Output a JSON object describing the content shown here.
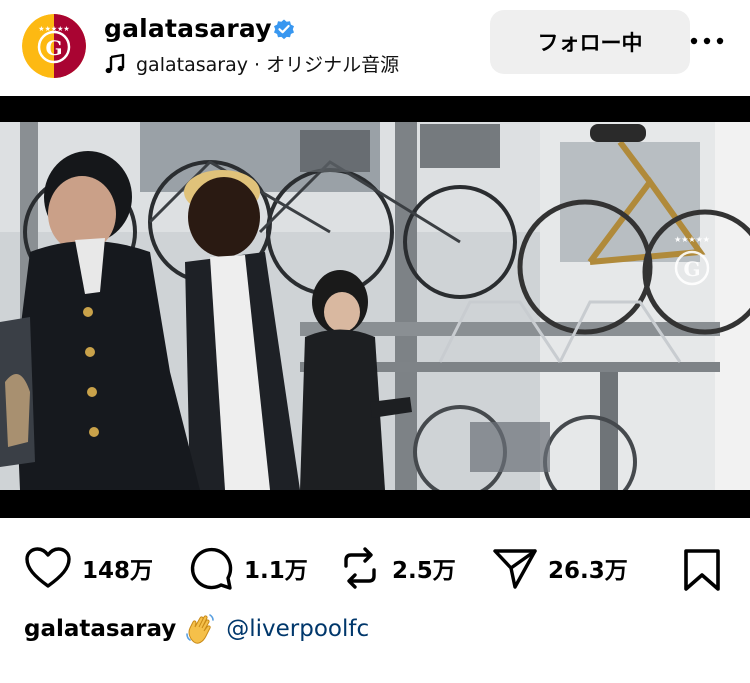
{
  "header": {
    "account_name": "galatasaray",
    "audio_label": "galatasaray · オリジナル音源",
    "follow_label": "フォロー中",
    "more_icon": "more-horizontal-icon",
    "verified_color": "#3897f0"
  },
  "media": {
    "type": "video",
    "sound_icon": "speaker-icon"
  },
  "actions": {
    "like_count": "148万",
    "comment_count": "1.1万",
    "repost_count": "2.5万",
    "share_count": "26.3万"
  },
  "caption": {
    "user": "galatasaray",
    "emoji": "👋",
    "mention": "@liverpoolfc",
    "mention_color": "#00376b"
  },
  "colors": {
    "brand_red": "#a90432",
    "brand_yellow": "#fdb912"
  }
}
